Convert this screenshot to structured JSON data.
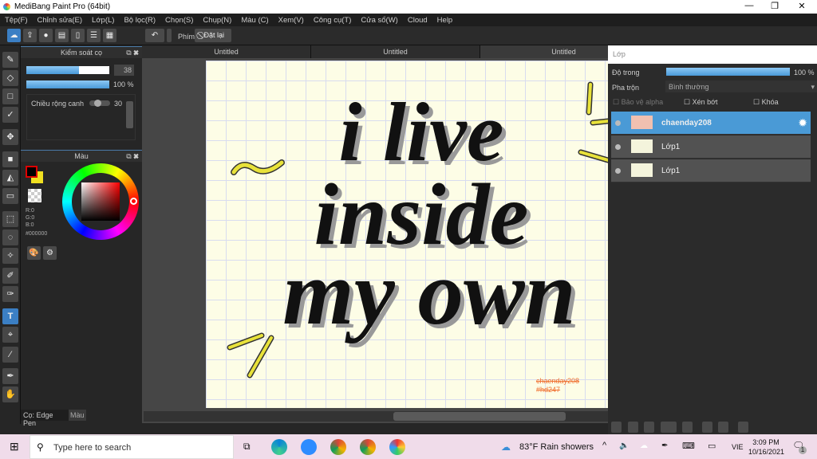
{
  "window": {
    "title": "MediBang Paint Pro (64bit)"
  },
  "menu": [
    "Tệp(F)",
    "Chỉnh sửa(E)",
    "Lớp(L)",
    "Bộ lọc(R)",
    "Chọn(S)",
    "Chụp(N)",
    "Màu (C)",
    "Xem(V)",
    "Công cụ(T)",
    "Cửa sổ(W)",
    "Cloud",
    "Help"
  ],
  "toolbar": {
    "key_label": "Phím",
    "reset_label": "Đặt lại"
  },
  "brush_panel": {
    "title": "Kiểm soát cọ",
    "size": "38",
    "size_fraction": 0.63,
    "opacity": "100 %",
    "edge_width_label": "Chiều rộng canh",
    "edge_width": "30"
  },
  "color_panel": {
    "title": "Màu",
    "r": "R:0",
    "g": "G:0",
    "b": "B:0",
    "hex": "#000000",
    "primary": "#000000",
    "secondary": "#f0e020"
  },
  "bottom_tabs": {
    "brush": "Cọ: Edge Pen",
    "color": "Màu"
  },
  "tabs": [
    "Untitled",
    "Untitled",
    "Untitled"
  ],
  "canvas": {
    "art_lines": [
      "i live",
      "inside",
      "my own"
    ],
    "signature": "chaenday208",
    "signature_tag": "#hd247",
    "bg": "#fdfde6"
  },
  "layers_panel": {
    "title": "Lớp",
    "opacity_label": "Độ trong",
    "opacity": "100 %",
    "blend_label": "Pha trộn",
    "blend": "Bình thường",
    "protect_alpha": "Bảo vệ alpha",
    "clip": "Xén bớt",
    "lock": "Khóa",
    "layers": [
      {
        "name": "chaenday208",
        "selected": true
      },
      {
        "name": "Lớp1",
        "selected": false
      },
      {
        "name": "Lớp1",
        "selected": false
      }
    ]
  },
  "taskbar": {
    "search_placeholder": "Type here to search",
    "weather": "83°F  Rain showers",
    "lang": "VIE",
    "time": "3:09 PM",
    "date": "10/16/2021",
    "notifications": "1"
  }
}
